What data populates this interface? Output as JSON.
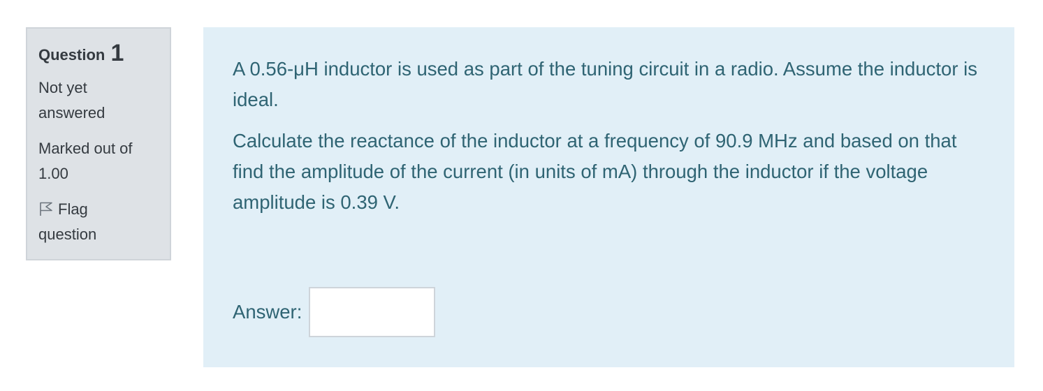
{
  "question_info": {
    "question_label": "Question",
    "question_number": "1",
    "state": "Not yet answered",
    "grade": "Marked out of 1.00",
    "flag_label": "Flag question"
  },
  "question_text": {
    "paragraph_1": "A 0.56-μH inductor is used as part of the tuning circuit in a radio. Assume the inductor is ideal.",
    "paragraph_2": "Calculate the reactance of the inductor at a frequency of 90.9 MHz and based on that find the amplitude of the current (in units of mA) through the inductor if the voltage amplitude is 0.39 V."
  },
  "answer": {
    "label": "Answer:",
    "value": ""
  },
  "colors": {
    "info_background": "#dee2e6",
    "content_background": "#e1eff7",
    "question_text": "#2f6473"
  },
  "icons": {
    "flag": "flag-icon"
  }
}
